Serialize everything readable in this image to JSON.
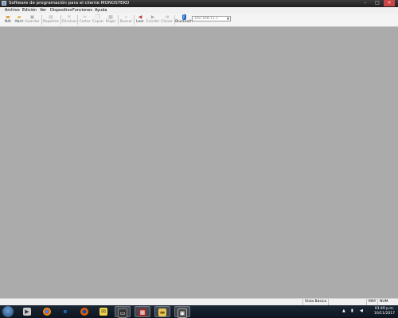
{
  "window": {
    "title": "Software de programación para el cliente MONOSTEKO",
    "controls": {
      "minimize": "–",
      "maximize": "□",
      "close": "✕"
    }
  },
  "menu": [
    "Archivo",
    "Edición",
    "Ver",
    "Dispositivo",
    "Funciones",
    "Ayuda"
  ],
  "toolbar": {
    "buttons": [
      {
        "label": "Nét",
        "icon": "new-icon"
      },
      {
        "label": "Abrir",
        "icon": "open-folder-icon"
      },
      {
        "label": "Guardar",
        "icon": "save-icon"
      },
      {
        "label": "Reportes",
        "icon": "report-icon"
      },
      {
        "label": "Eliminar",
        "icon": "delete-icon"
      },
      {
        "label": "Cortar",
        "icon": "cut-icon"
      },
      {
        "label": "Copiar",
        "icon": "copy-icon"
      },
      {
        "label": "Pegar",
        "icon": "paste-icon"
      },
      {
        "label": "Buscar",
        "icon": "search-icon"
      },
      {
        "label": "Leer",
        "icon": "read-icon"
      },
      {
        "label": "Escribir",
        "icon": "write-icon"
      },
      {
        "label": "Clonar",
        "icon": "clone-icon"
      },
      {
        "label": "Bluetooth",
        "icon": "bluetooth-icon"
      }
    ],
    "ip_address": "192.168.11.1"
  },
  "status": {
    "view_mode": "Vista Básico",
    "caps": "MAY",
    "num": "NUM"
  },
  "taskbar": {
    "time": "03:49 p.m.",
    "date": "10/11/2017"
  },
  "colors": {
    "workspace": "#ababab",
    "taskbar": "#16202c",
    "titlebar": "#2a2a2a"
  }
}
